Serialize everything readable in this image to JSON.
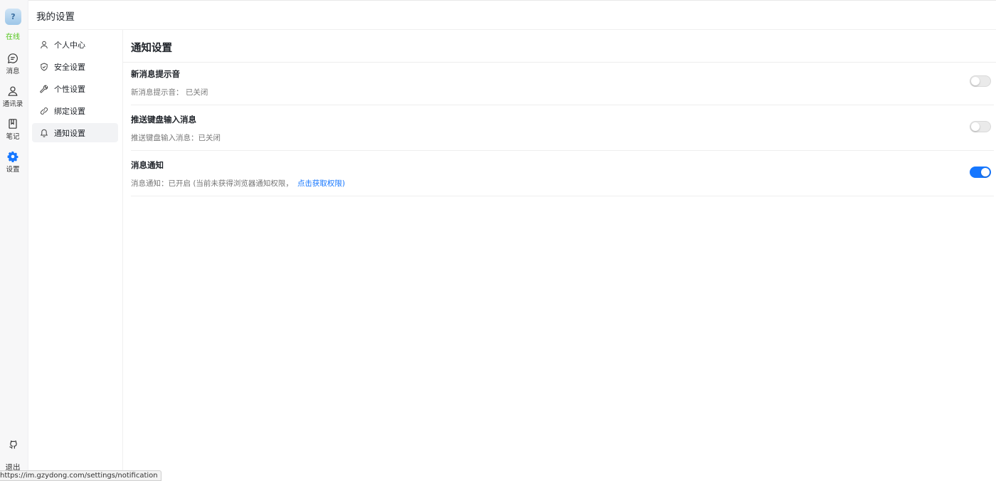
{
  "rail": {
    "status": "在线",
    "items": [
      {
        "label": "消息",
        "icon": "chat-bubble-icon"
      },
      {
        "label": "通讯录",
        "icon": "contacts-icon"
      },
      {
        "label": "笔记",
        "icon": "notebook-icon"
      },
      {
        "label": "设置",
        "icon": "gear-icon"
      }
    ],
    "logout_label": "退出"
  },
  "header": {
    "title": "我的设置"
  },
  "subnav": {
    "items": [
      {
        "label": "个人中心",
        "icon": "user-icon"
      },
      {
        "label": "安全设置",
        "icon": "shield-icon"
      },
      {
        "label": "个性设置",
        "icon": "wrench-icon"
      },
      {
        "label": "绑定设置",
        "icon": "link-icon"
      },
      {
        "label": "通知设置",
        "icon": "bell-icon"
      }
    ],
    "active_label": "通知设置"
  },
  "main": {
    "title": "通知设置",
    "settings": [
      {
        "name": "新消息提示音",
        "desc": "新消息提示音： 已关闭",
        "enabled": false
      },
      {
        "name": "推送键盘输入消息",
        "desc": "推送键盘输入消息：已关闭",
        "enabled": false
      },
      {
        "name": "消息通知",
        "desc": "消息通知：已开启 (当前未获得浏览器通知权限，",
        "link": "点击获取权限)",
        "enabled": true
      }
    ]
  },
  "status_url": "https://im.gzydong.com/settings/notification",
  "colors": {
    "accent": "#1677ff",
    "online": "#52c41a",
    "active_nav_bg": "#f2f3f5"
  }
}
